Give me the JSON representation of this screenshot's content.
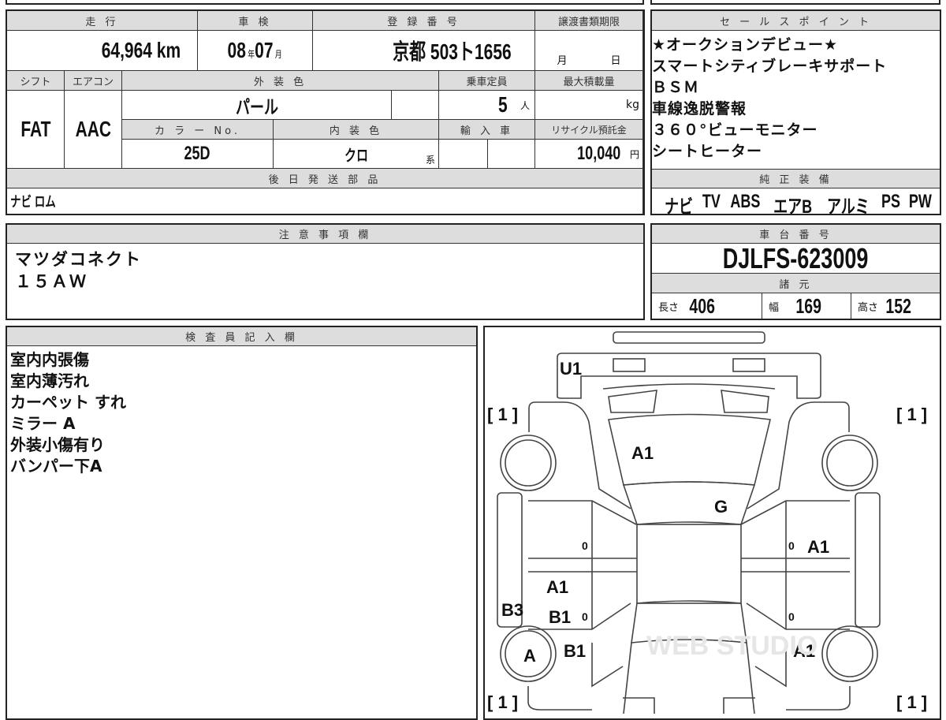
{
  "main": {
    "mileage_label": "走 行",
    "mileage": "64,964",
    "mileage_unit": "km",
    "inspection_label": "車 検",
    "insp_year": "08",
    "year_unit": "年",
    "insp_month": "07",
    "month_unit": "月",
    "reg_label": "登 録 番 号",
    "reg_number": "京都 503ト1656",
    "transfer_label": "譲渡書類期限",
    "transfer_month": "月",
    "transfer_day": "日",
    "shift_label": "シフト",
    "shift": "FAT",
    "ac_label": "エアコン",
    "ac": "AAC",
    "ext_color_label": "外 装 色",
    "ext_color": "パール",
    "capacity_label": "乗車定員",
    "capacity": "5",
    "capacity_unit": "人",
    "max_load_label": "最大積載量",
    "max_load_unit": "kg",
    "color_no_label": "カ ラ ー No.",
    "color_no": "25D",
    "int_color_label": "内 装 色",
    "int_color": "クロ",
    "int_color_suffix": "系",
    "import_label": "輸 入 車",
    "recycle_label": "リサイクル預託金",
    "recycle": "10,040",
    "recycle_unit": "円",
    "later_parts_label": "後 日 発 送 部 品",
    "later_parts": "ナビ ロム"
  },
  "sales": {
    "label": "セ ー ル ス ポ イ ン ト",
    "lines": [
      "★オークションデビュー★",
      "スマートシティブレーキサポート",
      "ＢＳＭ",
      "車線逸脱警報",
      "３６０°ビューモニター",
      "シートヒーター"
    ]
  },
  "equipment": {
    "label": "純 正 装 備",
    "items": [
      "ナビ",
      "TV",
      "ABS",
      "エアB",
      "アルミ",
      "PS",
      "PW"
    ]
  },
  "notes": {
    "label": "注 意 事 項 欄",
    "text": "マツダコネクト\n１５ＡＷ"
  },
  "chassis": {
    "label": "車 台 番 号",
    "number": "DJLFS-623009",
    "spec_label": "諸 元",
    "length_label": "長さ",
    "length": "406",
    "width_label": "幅",
    "width": "169",
    "height_label": "高さ",
    "height": "152"
  },
  "inspector": {
    "label": "検 査 員 記 入 欄",
    "lines": [
      "室内内張傷",
      "室内薄汚れ",
      "カーペット すれ",
      "ミラー A",
      "外装小傷有り",
      "バンパー下A"
    ]
  },
  "diagram": {
    "marks": [
      "U1",
      "A1",
      "G",
      "A1",
      "A1",
      "B1",
      "B3",
      "A",
      "B1",
      "A1",
      "[ 1 ]",
      "[ 1 ]",
      "[ 1 ]",
      "[ 1 ]",
      "0",
      "0",
      "0",
      "0"
    ],
    "watermark": "WEB STUDIO"
  }
}
